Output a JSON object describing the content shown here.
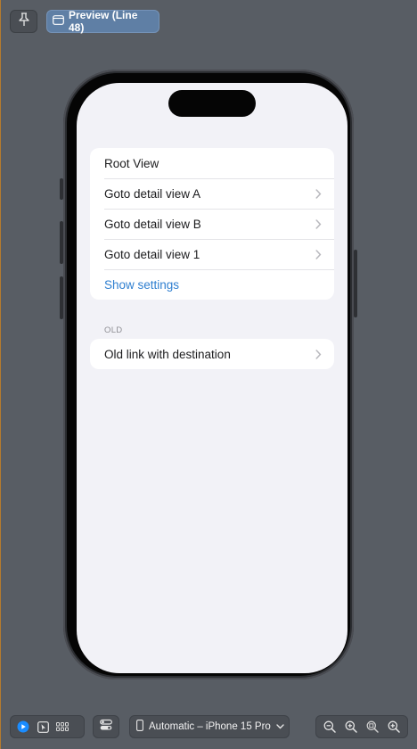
{
  "toolbar": {
    "pin_icon": "pin-icon",
    "preview_label": "Preview (Line 48)",
    "preview_icon": "window-icon"
  },
  "list": {
    "group1": [
      {
        "label": "Root View",
        "chevron": false,
        "link": false
      },
      {
        "label": "Goto detail view A",
        "chevron": true,
        "link": false
      },
      {
        "label": "Goto detail view B",
        "chevron": true,
        "link": false
      },
      {
        "label": "Goto detail view 1",
        "chevron": true,
        "link": false
      },
      {
        "label": "Show settings",
        "chevron": false,
        "link": true
      }
    ],
    "section_header": "OLD",
    "group2": [
      {
        "label": "Old link with destination",
        "chevron": true,
        "link": false
      }
    ]
  },
  "bottom_bar": {
    "device_label": "Automatic – iPhone 15 Pro",
    "modes": [
      "live-preview-icon",
      "selectable-icon",
      "variants-grid-icon"
    ],
    "settings_icon": "device-settings-icon",
    "zoom": [
      "zoom-out-icon",
      "zoom-in-icon",
      "zoom-to-fit-icon",
      "zoom-100-icon"
    ]
  },
  "colors": {
    "canvas": "#585d64",
    "accent": "#2f7fd0",
    "screen_bg": "#f2f2f7",
    "preview_button": "#5f7fa5"
  }
}
